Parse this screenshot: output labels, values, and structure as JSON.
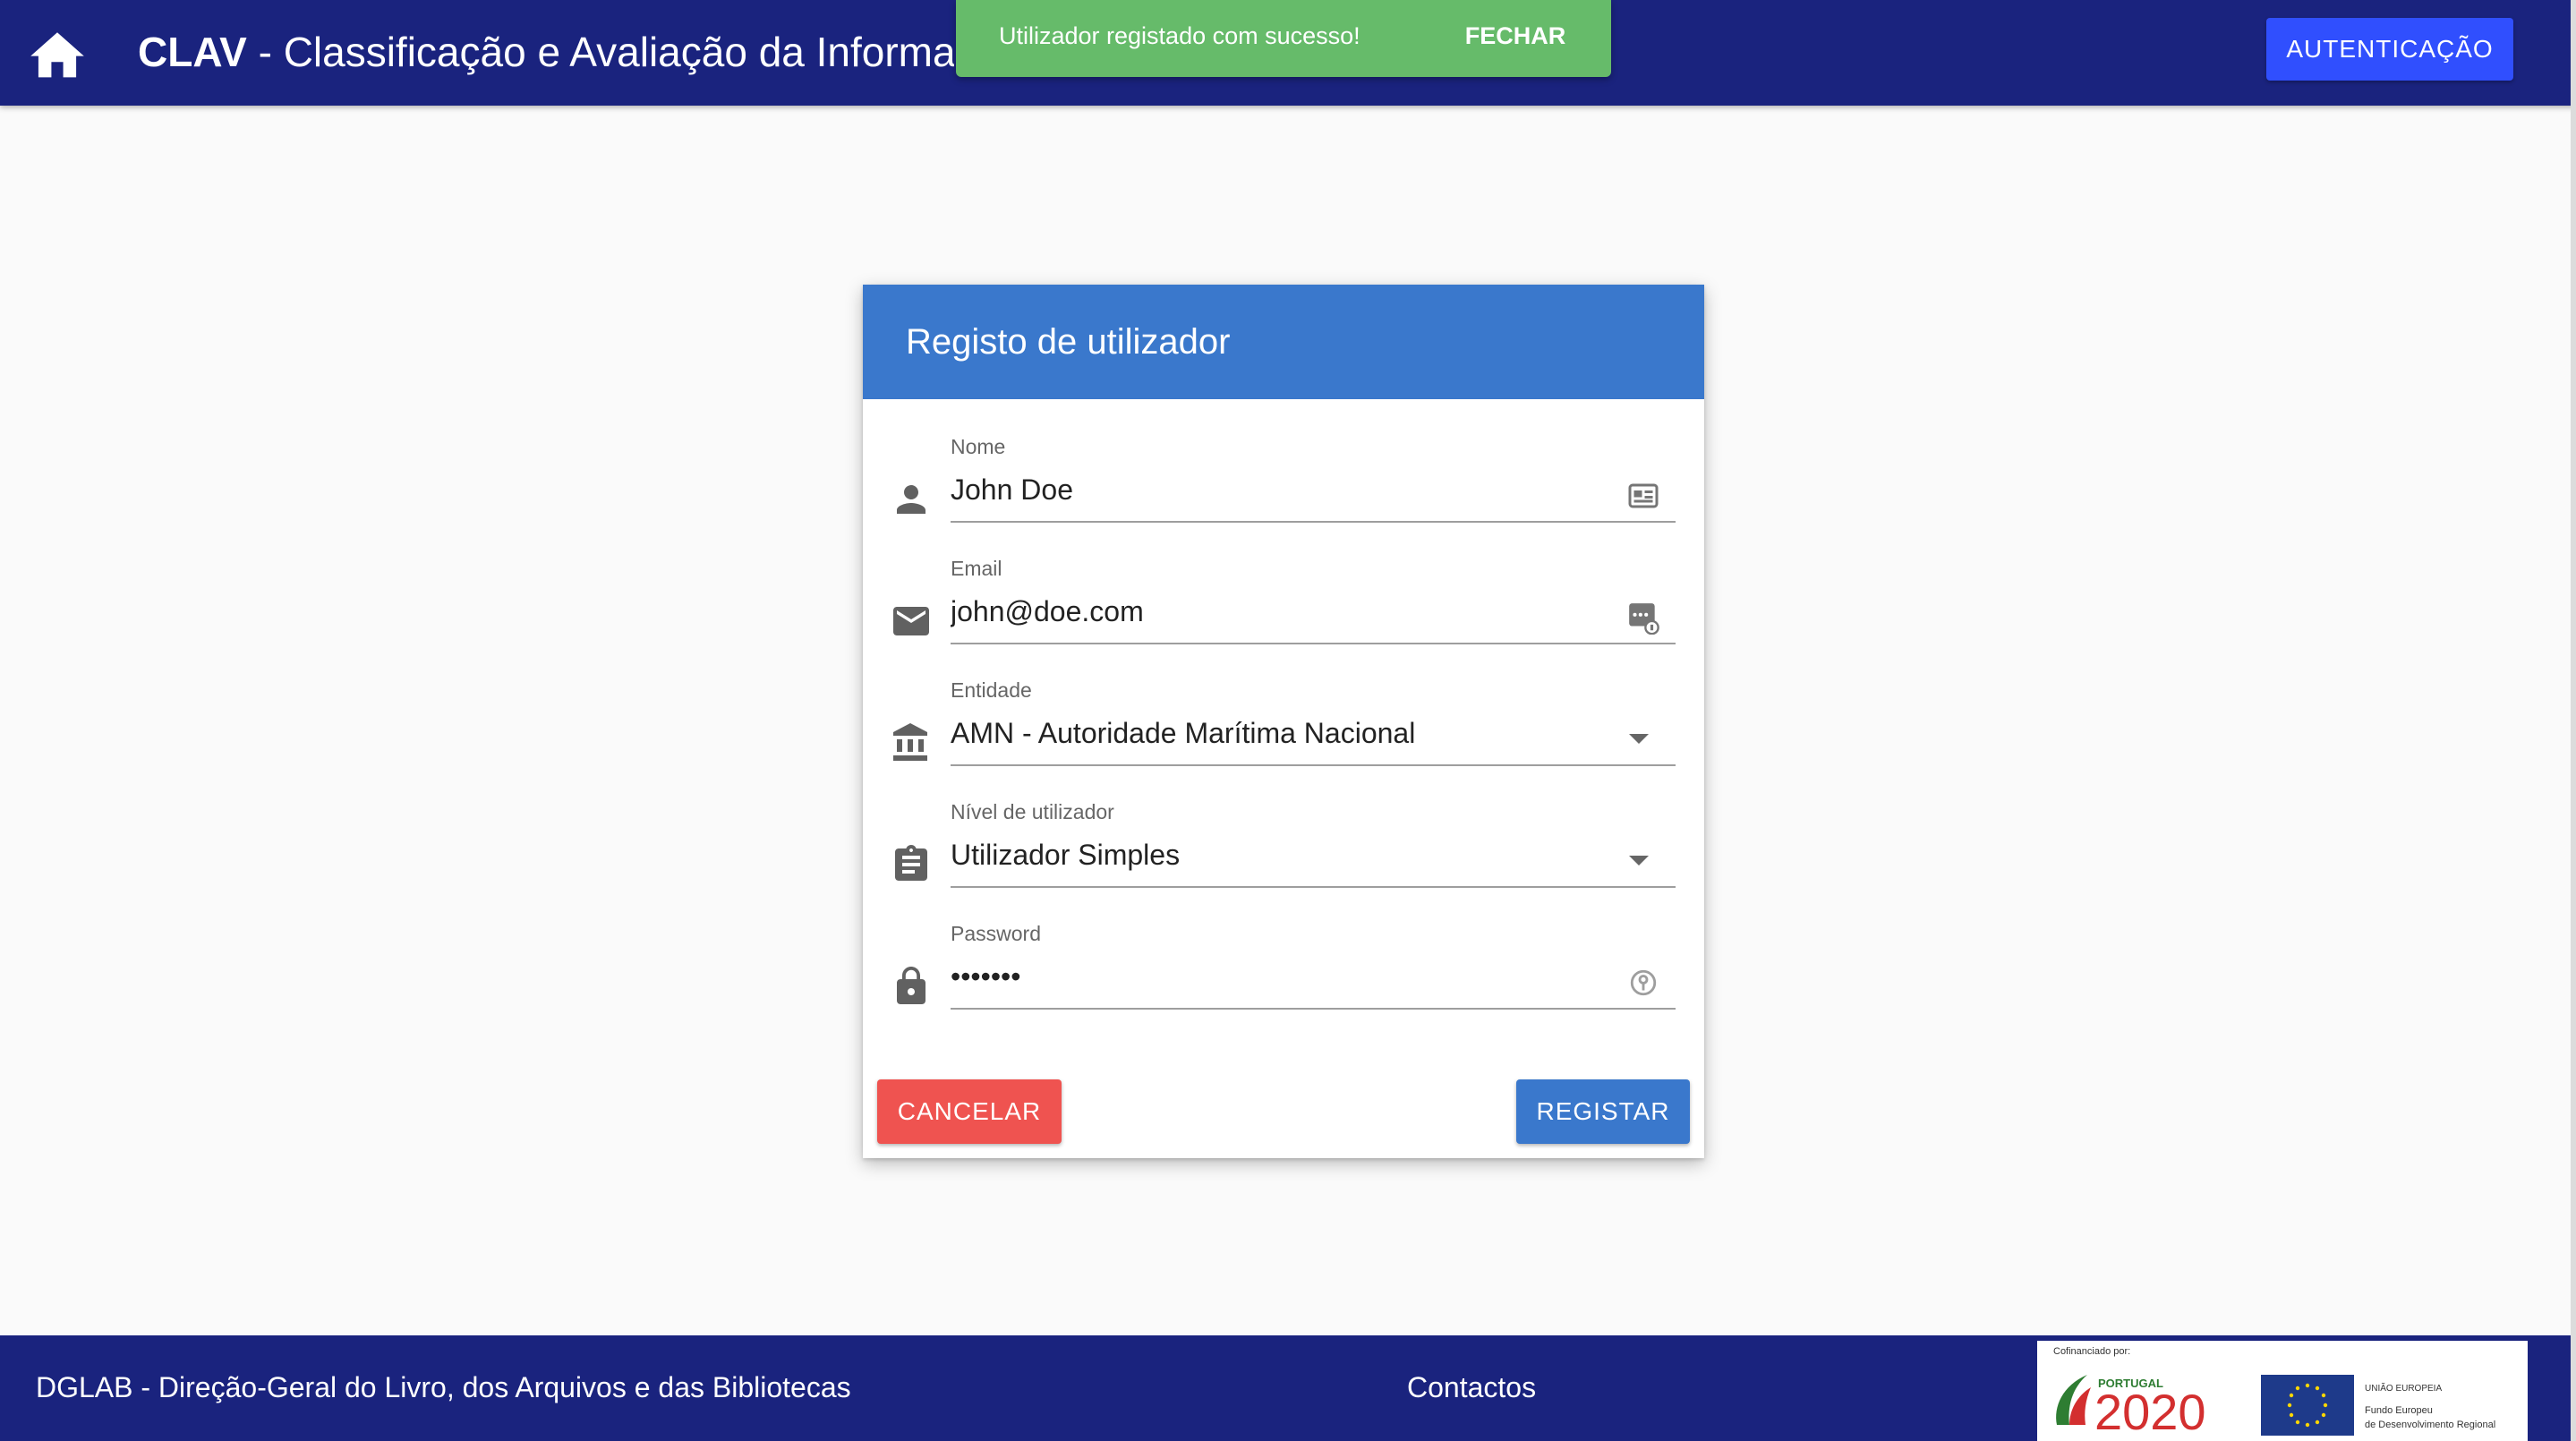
{
  "appbar": {
    "title_bold": "CLAV",
    "title_rest": " - Classificação e Avaliação da Informação Pública",
    "login_label": "AUTENTICAÇÃO",
    "home_icon": "home-icon"
  },
  "snackbar": {
    "message": "Utilizador registado com sucesso!",
    "close_label": "FECHAR"
  },
  "form": {
    "title": "Registo de utilizador",
    "fields": [
      {
        "label": "Nome",
        "value": "John Doe",
        "icon": "person-icon",
        "append_icon": "contact-card-icon"
      },
      {
        "label": "Email",
        "value": "john@doe.com",
        "icon": "mail-icon",
        "append_icon": "password-autofill-icon"
      },
      {
        "label": "Entidade",
        "value": "AMN - Autoridade Marítima Nacional",
        "icon": "bank-icon",
        "append_icon": "chevron-down-icon"
      },
      {
        "label": "Nível de utilizador",
        "value": "Utilizador Simples",
        "icon": "clipboard-icon",
        "append_icon": "chevron-down-icon"
      },
      {
        "label": "Password",
        "value": "•••••••",
        "icon": "lock-icon",
        "append_icon": "key-icon"
      }
    ],
    "cancel_label": "CANCELAR",
    "register_label": "REGISTAR"
  },
  "footer": {
    "org": "DGLAB - Direção-Geral do Livro, dos Arquivos e das Bibliotecas",
    "contacts": "Contactos",
    "sponsor": {
      "cofinanced": "Cofinanciado por:",
      "portugal": "PORTUGAL",
      "year": "2020",
      "eu_title": "UNIÃO EUROPEIA",
      "fund_line1": "Fundo Europeu",
      "fund_line2": "de Desenvolvimento Regional"
    }
  },
  "colors": {
    "appbar": "#1a237e",
    "primary": "#3a78cc",
    "accent": "#304ffe",
    "success": "#66bb6a",
    "error": "#ef5350"
  }
}
